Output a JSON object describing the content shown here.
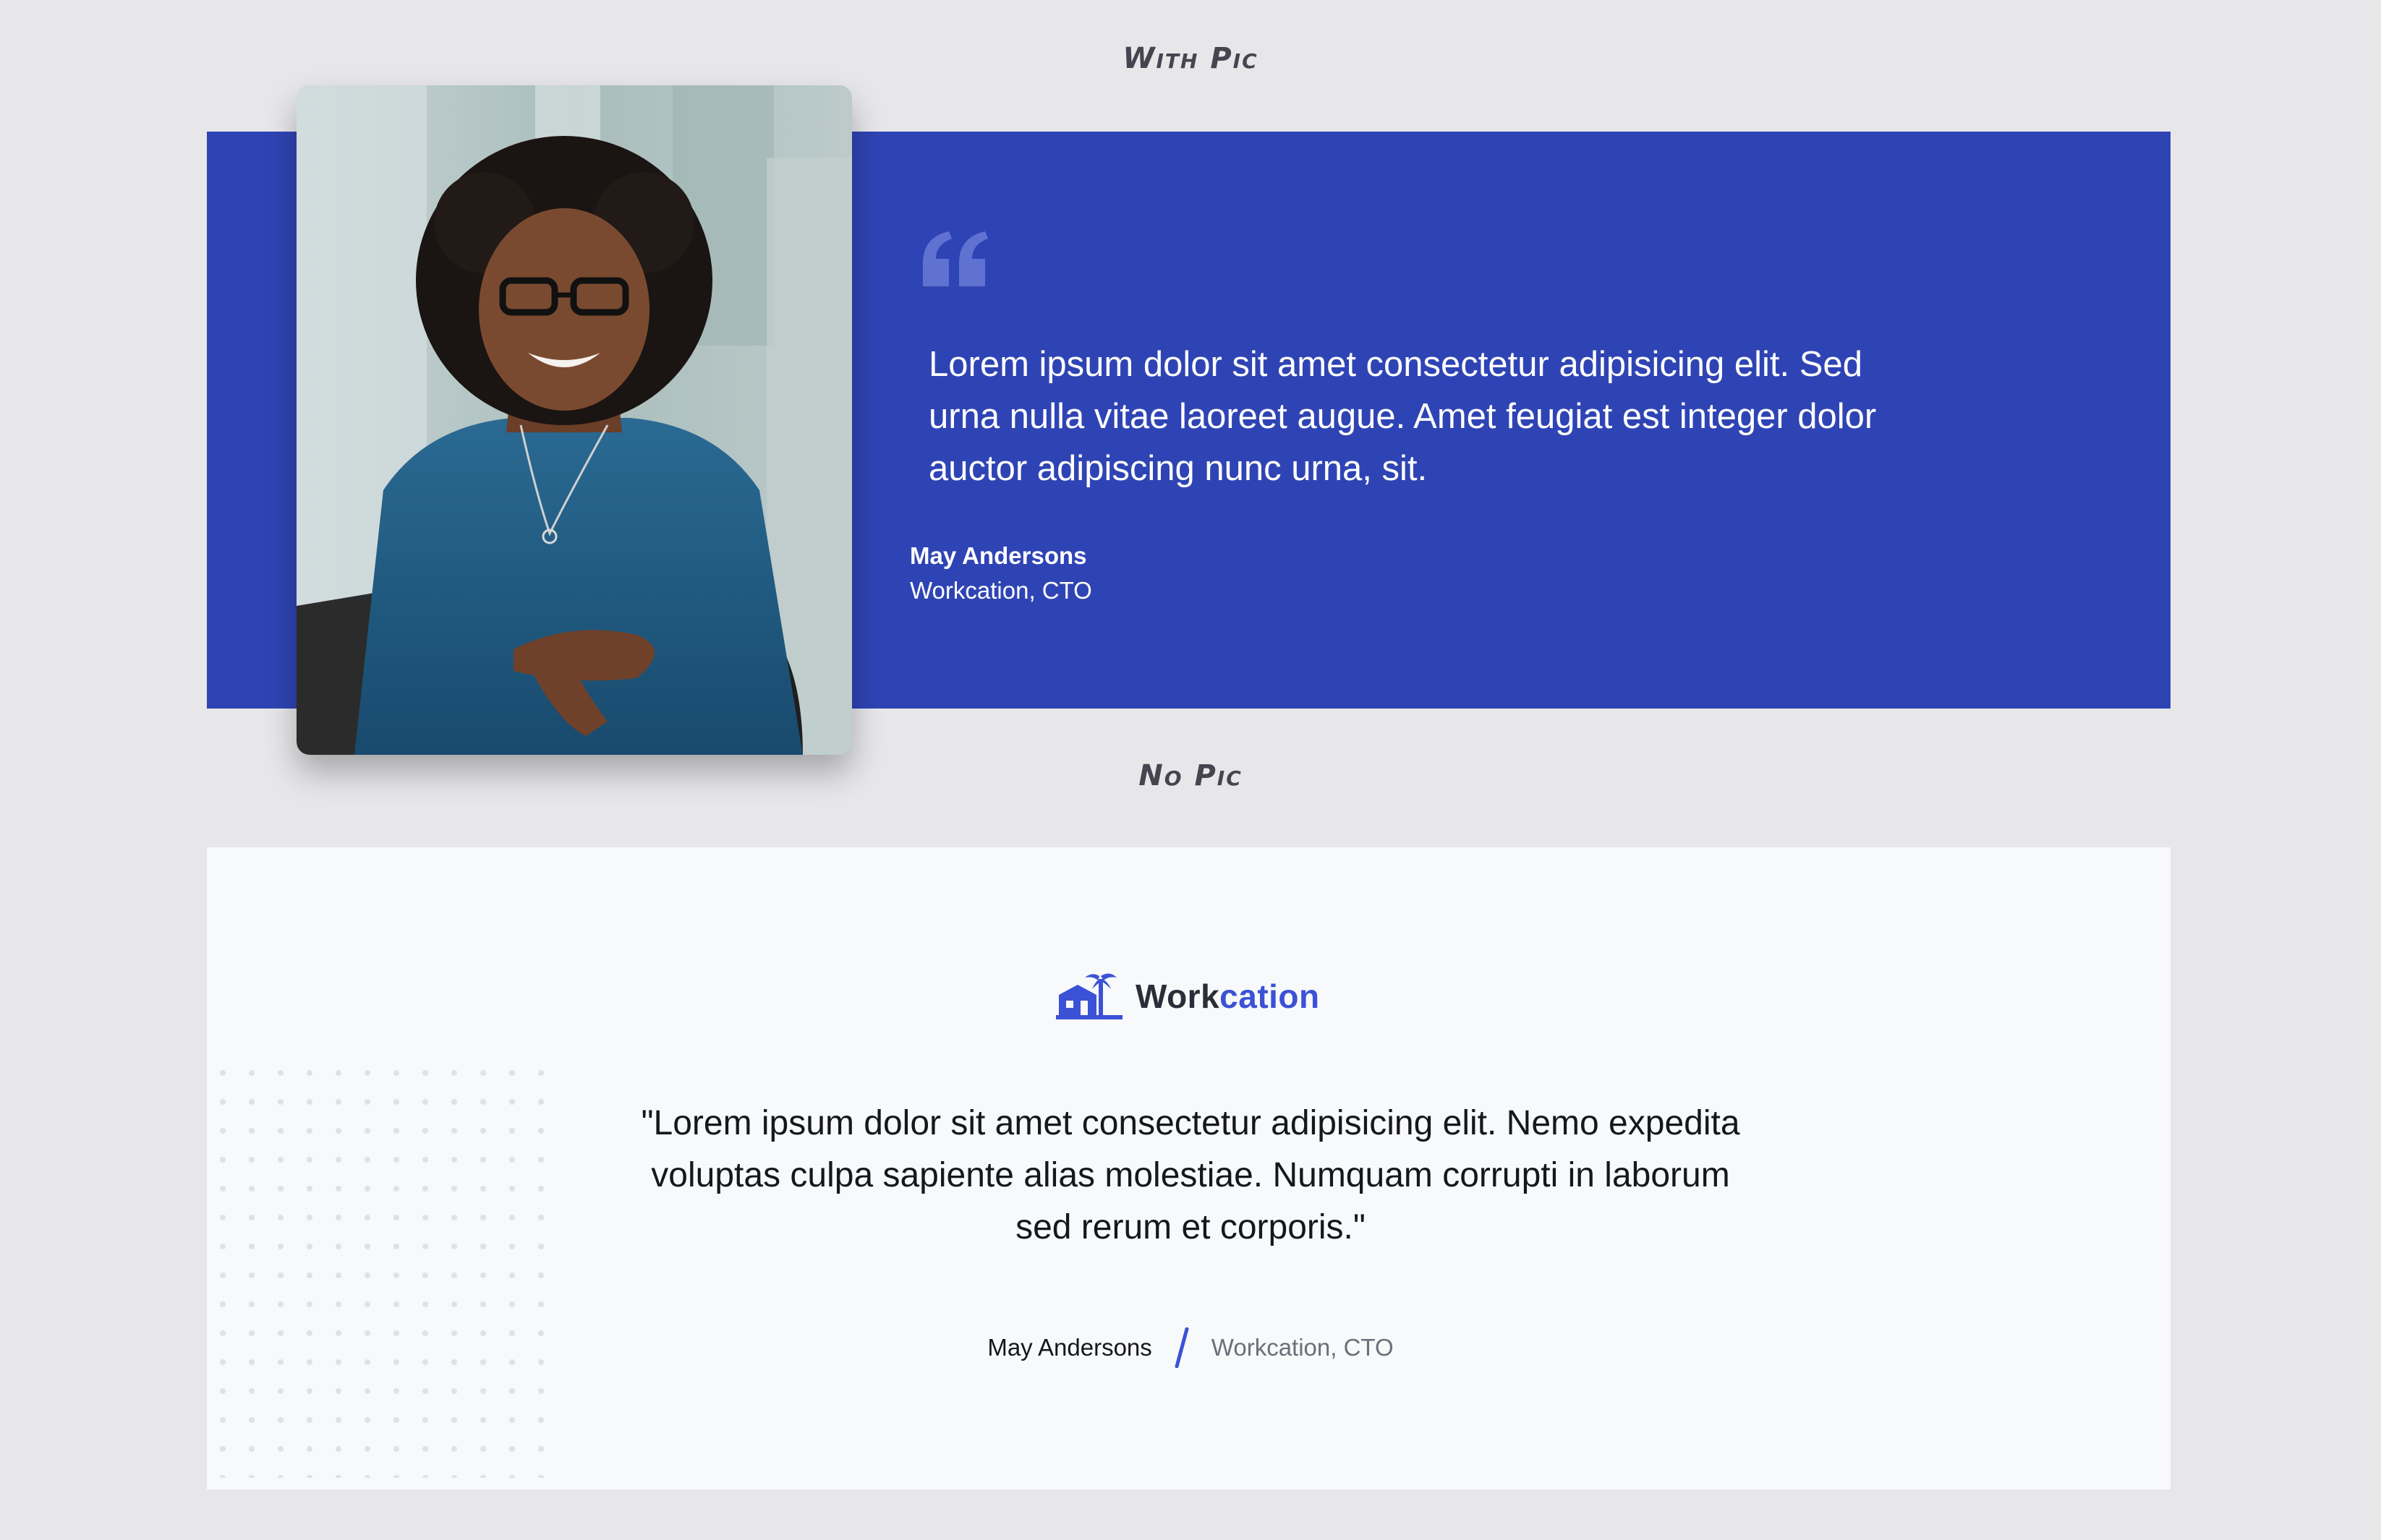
{
  "sections": {
    "with_pic_label": "With Pic",
    "no_pic_label": "No Pic"
  },
  "with_pic": {
    "quote": "Lorem ipsum dolor sit amet consectetur adipisicing elit. Sed urna nulla vitae laoreet augue. Amet feugiat est integer dolor auctor adipiscing nunc urna, sit.",
    "author_name": "May Andersons",
    "author_role": "Workcation, CTO",
    "quote_icon": "quote-mark-icon"
  },
  "no_pic": {
    "logo": {
      "word_dark": "Work",
      "word_accent": "cation",
      "icon": "house-palm-logo-icon"
    },
    "quote": "\"Lorem ipsum dolor sit amet consectetur adipisicing elit. Nemo expedita voluptas culpa sapiente alias molestiae. Numquam corrupti in laborum sed rerum et corporis.\"",
    "author_name": "May Andersons",
    "author_role": "Workcation, CTO"
  },
  "colors": {
    "page_bg": "#e7e7ea",
    "brand_blue": "#2f44b4",
    "accent": "#3b52d6",
    "card_bg": "#f8f9fa",
    "text_dark": "#15171d",
    "text_muted": "#6b6f79"
  }
}
